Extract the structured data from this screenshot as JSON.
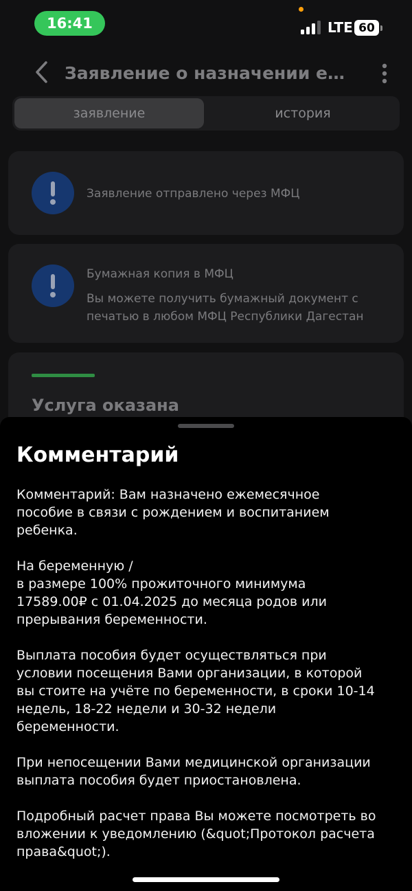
{
  "status_bar": {
    "time": "16:41",
    "network": "LTE",
    "battery": "60"
  },
  "header": {
    "title": "Заявление о назначении ежемесячного пособия"
  },
  "tabs": [
    {
      "label": "заявление",
      "active": true
    },
    {
      "label": "история",
      "active": false
    }
  ],
  "cards": {
    "sent": {
      "text": "Заявление отправлено через МФЦ"
    },
    "paper_copy": {
      "title": "Бумажная копия в МФЦ",
      "text": "Вы можете получить бумажный документ с печатью в любом МФЦ Республики Дагестан"
    },
    "service": {
      "status": "Услуга оказана"
    }
  },
  "sheet": {
    "title": "Комментарий",
    "paragraphs": [
      "Комментарий: Вам назначено ежемесячное\nпособие в связи с рождением и воспитанием\nребенка.",
      "На беременную /\nв размере 100% прожиточного минимума\n17589.00₽ с 01.04.2025 до месяца родов или\nпрерывания беременности.",
      "Выплата пособия будет осуществляться при\nусловии посещения Вами организации, в которой\nвы стоите на учёте по беременности, в сроки 10-14\nнедель, 18-22 недели и 30-32 недели\nбеременности.",
      "При непосещении Вами медицинской организации\nвыплата пособия будет приостановлена.",
      "Подробный расчет права Вы можете посмотреть во\nвложении к уведомлению (&quot;Протокол расчета\nправа&quot;)."
    ]
  },
  "colors": {
    "time_pill": "#35c65a",
    "alert_icon_bg": "#16376f",
    "progress_green": "#2f8d43"
  },
  "icons": {
    "back": "chevron-left-icon",
    "menu": "kebab-menu-icon",
    "alert": "exclamation-icon"
  }
}
